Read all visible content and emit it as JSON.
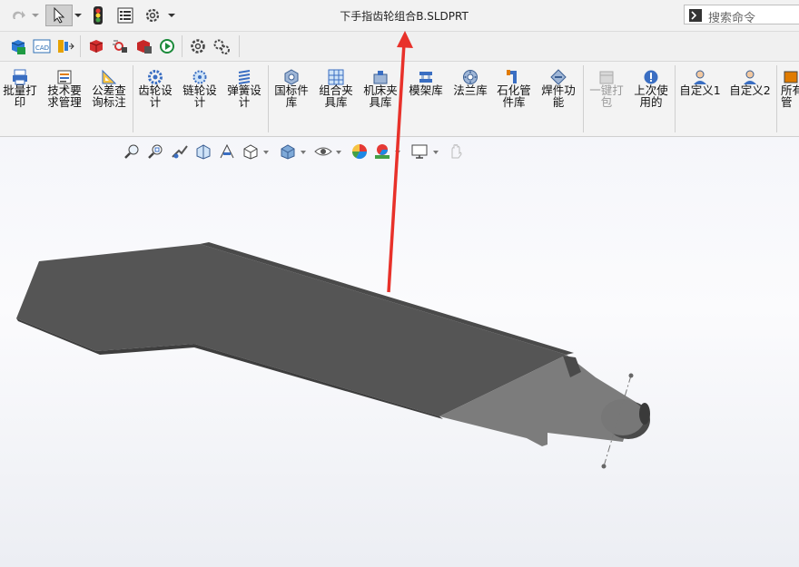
{
  "window": {
    "title": "下手指齿轮组合B.SLDPRT"
  },
  "search": {
    "placeholder": "搜索命令"
  },
  "quick_toolbar": {
    "icons": [
      "redo-icon",
      "select-pointer-icon",
      "traffic-light-icon",
      "properties-icon",
      "settings-gear-icon"
    ]
  },
  "row2_icons": [
    "cube-save-icon",
    "cad-icon",
    "convert-icon",
    "red-cube-icon",
    "motion-icon",
    "cube-edit-icon",
    "play-icon",
    "gear-icon",
    "gears-icon"
  ],
  "ribbon": {
    "buttons": [
      {
        "label": "批量打\n印",
        "icon": "batch-print-icon",
        "enabled": true
      },
      {
        "label": "技术要\n求管理",
        "icon": "tech-requirements-icon",
        "enabled": true
      },
      {
        "label": "公差查\n询标注",
        "icon": "tolerance-icon",
        "enabled": true
      },
      {
        "label": "齿轮设\n计",
        "icon": "gear-design-icon",
        "enabled": true
      },
      {
        "label": "链轮设\n计",
        "icon": "sprocket-design-icon",
        "enabled": true
      },
      {
        "label": "弹簧设\n计",
        "icon": "spring-design-icon",
        "enabled": true
      },
      {
        "label": "国标件\n库",
        "icon": "standard-parts-icon",
        "enabled": true
      },
      {
        "label": "组合夹\n具库",
        "icon": "fixture-library-icon",
        "enabled": true
      },
      {
        "label": "机床夹\n具库",
        "icon": "machine-fixture-icon",
        "enabled": true
      },
      {
        "label": "模架库",
        "icon": "mold-base-icon",
        "enabled": true
      },
      {
        "label": "法兰库",
        "icon": "flange-icon",
        "enabled": true
      },
      {
        "label": "石化管\n件库",
        "icon": "pipe-fitting-icon",
        "enabled": true
      },
      {
        "label": "焊件功\n能",
        "icon": "weldment-icon",
        "enabled": true
      },
      {
        "label": "一键打\n包",
        "icon": "pack-icon",
        "enabled": false
      },
      {
        "label": "上次使\n用的",
        "icon": "recent-icon",
        "enabled": true
      },
      {
        "label": "自定义1",
        "icon": "custom1-icon",
        "enabled": true
      },
      {
        "label": "自定义2",
        "icon": "custom2-icon",
        "enabled": true
      },
      {
        "label": "所有\n管",
        "icon": "all-manage-icon",
        "enabled": true
      }
    ]
  },
  "heads_up_toolbar": {
    "icons": [
      "zoom-fit-icon",
      "zoom-area-icon",
      "previous-view-icon",
      "section-view-icon",
      "dynamic-annotation-icon",
      "view-orientation-icon",
      "display-style-icon",
      "hide-show-icon",
      "edit-appearance-icon",
      "apply-scene-icon",
      "view-settings-icon",
      "realview-icon"
    ]
  },
  "colors": {
    "accent_arrow": "#e8312a",
    "part_dark": "#555555",
    "part_light": "#7a7a7a"
  }
}
